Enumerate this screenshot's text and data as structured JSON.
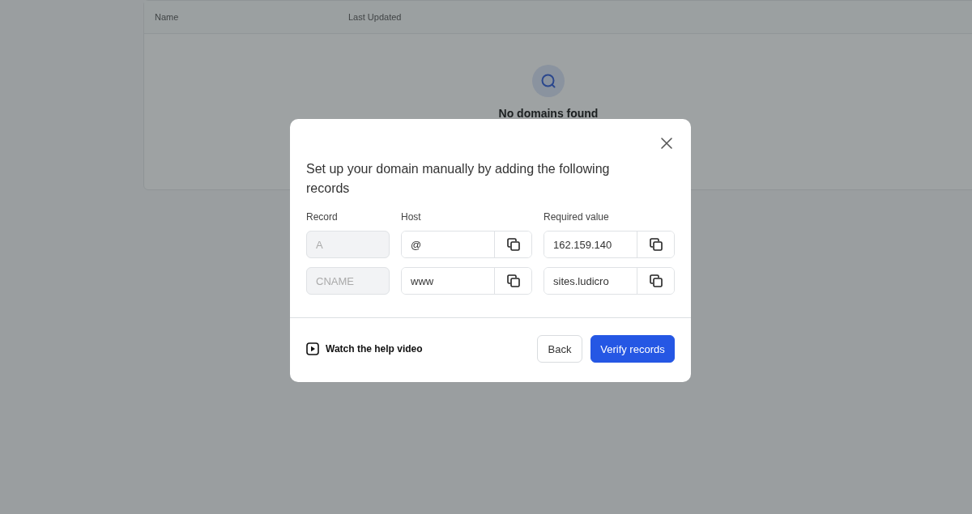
{
  "table": {
    "columns": [
      "Name",
      "Last Updated"
    ],
    "empty_state": {
      "title": "No domains found"
    }
  },
  "dialog": {
    "title": "Set up your domain manually by adding the following records",
    "columns": [
      "Record",
      "Host",
      "Required value"
    ],
    "records": [
      {
        "record": "A",
        "record_disabled": true,
        "host": "@",
        "value": "162.159.140"
      },
      {
        "record": "CNAME",
        "record_disabled": true,
        "host": "www",
        "value": "sites.ludicro"
      }
    ],
    "help_link": "Watch the help video",
    "buttons": [
      {
        "label": "Back",
        "kind": "secondary"
      },
      {
        "label": "Verify records",
        "kind": "primary"
      }
    ]
  }
}
